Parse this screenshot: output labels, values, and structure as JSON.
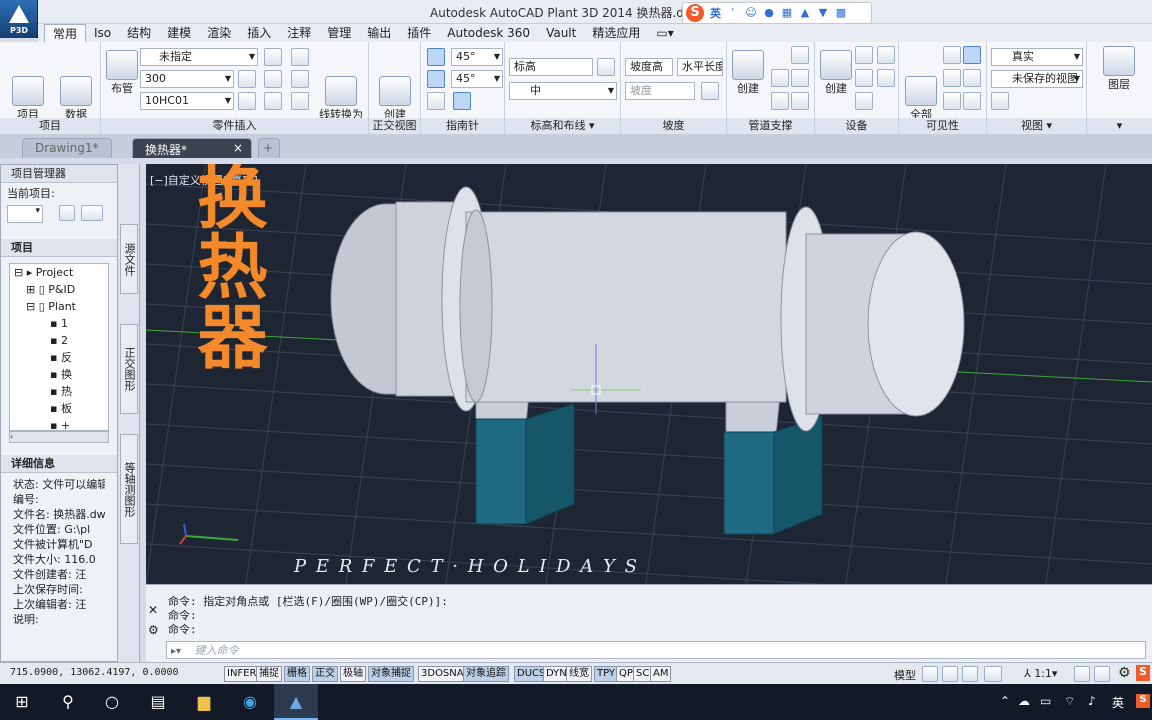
{
  "app": {
    "logo_text": "P3D",
    "title": "Autodesk AutoCAD Plant 3D 2014    换热器.dwg"
  },
  "ime": {
    "s": "S",
    "lang": "英",
    "icons": [
      "punct-icon",
      "emoji-icon",
      "mic-icon",
      "keyboard-icon",
      "toolbox-icon",
      "skin-icon",
      "grid-icon"
    ]
  },
  "ribbon_tabs": [
    "常用",
    "Iso",
    "结构",
    "建模",
    "渲染",
    "插入",
    "注释",
    "管理",
    "输出",
    "插件",
    "Autodesk 360",
    "Vault",
    "精选应用"
  ],
  "ribbon": {
    "project": {
      "label": "项目",
      "btn1": "项目\n管理器",
      "btn2": "数据\n管理器"
    },
    "parts": {
      "label": "零件插入",
      "btn_route": "布管",
      "combo1": "未指定",
      "combo2": "300",
      "combo3": "10HC01",
      "btn_convert": "线转换为\n管道"
    },
    "ortho": {
      "label": "正交视图",
      "btn": "创建\n正交视图"
    },
    "compass": {
      "label": "指南针",
      "angle1": "45°",
      "angle2": "45°"
    },
    "elev": {
      "label": "标高和布线",
      "field": "标高",
      "combo": "中"
    },
    "slope": {
      "label": "坡度",
      "field1": "坡度高",
      "field2": "水平长度",
      "field3": "坡度"
    },
    "support": {
      "label": "管道支撑",
      "btn": "创建"
    },
    "equipment": {
      "label": "设备",
      "btn": "创建"
    },
    "visibility": {
      "label": "可见性",
      "btn": "全部\n显示"
    },
    "view": {
      "label": "视图",
      "style": "真实",
      "saved": "未保存的视图"
    },
    "layers": {
      "label": "图层",
      "btn": "图层"
    }
  },
  "doc_tabs": [
    "Drawing1*",
    "换热器*"
  ],
  "viewport": {
    "label": "[−]自定义视图][真实]",
    "overlay_title": "换热器",
    "watermark": "P E R F E C T · H O L I D A Y S"
  },
  "project_manager": {
    "title": "项目管理器",
    "current_label": "当前项目:",
    "section_project": "项目",
    "tree": [
      "Project",
      "P&ID",
      "Plant",
      "1",
      "2",
      "反",
      "换",
      "热",
      "板",
      "+"
    ],
    "details_title": "详细信息",
    "details": [
      "状态: 文件可以编辑",
      "编号:",
      "文件名: 换热器.dwg",
      "文件位置: G:\\pl",
      "文件被计算机\"D",
      "文件大小: 116.0",
      "文件创建者: 汪",
      "上次保存时间:",
      "上次编辑者: 汪",
      "说明:"
    ],
    "side_tabs": [
      "源文件",
      "正交图形",
      "等轴测图形"
    ]
  },
  "command": {
    "history": [
      "命令: 指定对角点或 [栏选(F)/圈围(WP)/圈交(CP)]:",
      "命令:",
      "命令:"
    ],
    "placeholder": "键入命令"
  },
  "status": {
    "coords": "715.0900,   13062.4197, 0.0000",
    "toggles": [
      "INFER",
      "捕捉",
      "栅格",
      "正交",
      "极轴",
      "对象捕捉",
      "3DOSNAP",
      "对象追踪",
      "DUCS",
      "DYN",
      "线宽",
      "TPY",
      "QP",
      "SC",
      "AM"
    ],
    "model": "模型",
    "scale": "1:1"
  },
  "taskbar": {
    "lang": "英"
  }
}
